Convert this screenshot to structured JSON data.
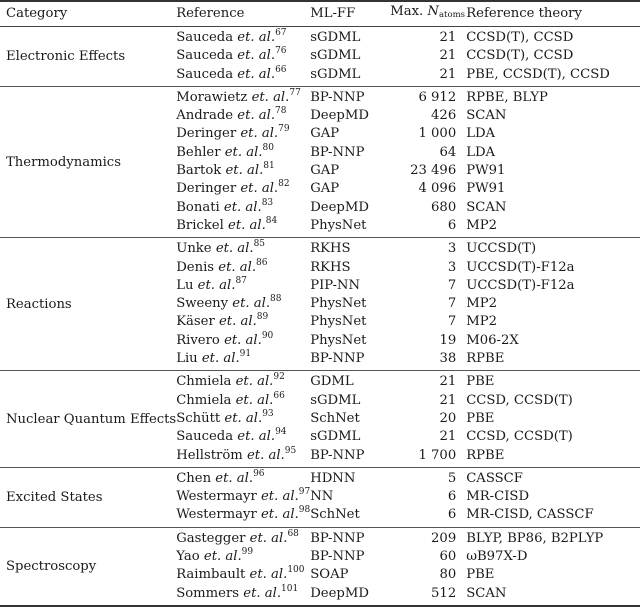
{
  "header": {
    "category": "Category",
    "reference": "Reference",
    "mlff": "ML-FF",
    "max_natoms_prefix": "Max.",
    "max_natoms_symbol": "N",
    "max_natoms_subscript": "atoms",
    "reference_theory": "Reference theory"
  },
  "etal": "et. al.",
  "groups": [
    {
      "category": "Electronic Effects",
      "rows": [
        {
          "author": "Sauceda",
          "ref": "67",
          "mlff": "sGDML",
          "natoms": "21",
          "theory": "CCSD(T), CCSD"
        },
        {
          "author": "Sauceda",
          "ref": "76",
          "mlff": "sGDML",
          "natoms": "21",
          "theory": "CCSD(T), CCSD"
        },
        {
          "author": "Sauceda",
          "ref": "66",
          "mlff": "sGDML",
          "natoms": "21",
          "theory": "PBE, CCSD(T), CCSD"
        }
      ]
    },
    {
      "category": "Thermodynamics",
      "rows": [
        {
          "author": "Morawietz",
          "ref": "77",
          "mlff": "BP-NNP",
          "natoms": "6 912",
          "theory": "RPBE, BLYP"
        },
        {
          "author": "Andrade",
          "ref": "78",
          "mlff": "DeepMD",
          "natoms": "426",
          "theory": "SCAN"
        },
        {
          "author": "Deringer",
          "ref": "79",
          "mlff": "GAP",
          "natoms": "1 000",
          "theory": "LDA"
        },
        {
          "author": "Behler",
          "ref": "80",
          "mlff": "BP-NNP",
          "natoms": "64",
          "theory": "LDA"
        },
        {
          "author": "Bartok",
          "ref": "81",
          "mlff": "GAP",
          "natoms": "23 496",
          "theory": "PW91"
        },
        {
          "author": "Deringer",
          "ref": "82",
          "mlff": "GAP",
          "natoms": "4 096",
          "theory": "PW91"
        },
        {
          "author": "Bonati",
          "ref": "83",
          "mlff": "DeepMD",
          "natoms": "680",
          "theory": "SCAN"
        },
        {
          "author": "Brickel",
          "ref": "84",
          "mlff": "PhysNet",
          "natoms": "6",
          "theory": "MP2"
        }
      ]
    },
    {
      "category": "Reactions",
      "rows": [
        {
          "author": "Unke",
          "ref": "85",
          "mlff": "RKHS",
          "natoms": "3",
          "theory": "UCCSD(T)"
        },
        {
          "author": "Denis",
          "ref": "86",
          "mlff": "RKHS",
          "natoms": "3",
          "theory": "UCCSD(T)-F12a"
        },
        {
          "author": "Lu",
          "ref": "87",
          "mlff": "PIP-NN",
          "natoms": "7",
          "theory": "UCCSD(T)-F12a"
        },
        {
          "author": "Sweeny",
          "ref": "88",
          "mlff": "PhysNet",
          "natoms": "7",
          "theory": "MP2"
        },
        {
          "author": "Käser",
          "ref": "89",
          "mlff": "PhysNet",
          "natoms": "7",
          "theory": "MP2"
        },
        {
          "author": "Rivero",
          "ref": "90",
          "mlff": "PhysNet",
          "natoms": "19",
          "theory": "M06-2X"
        },
        {
          "author": "Liu",
          "ref": "91",
          "mlff": "BP-NNP",
          "natoms": "38",
          "theory": "RPBE"
        }
      ]
    },
    {
      "category": "Nuclear Quantum Effects",
      "rows": [
        {
          "author": "Chmiela",
          "ref": "92",
          "mlff": "GDML",
          "natoms": "21",
          "theory": "PBE"
        },
        {
          "author": "Chmiela",
          "ref": "66",
          "mlff": "sGDML",
          "natoms": "21",
          "theory": "CCSD, CCSD(T)"
        },
        {
          "author": "Schütt",
          "ref": "93",
          "mlff": "SchNet",
          "natoms": "20",
          "theory": "PBE"
        },
        {
          "author": "Sauceda",
          "ref": "94",
          "mlff": "sGDML",
          "natoms": "21",
          "theory": "CCSD, CCSD(T)"
        },
        {
          "author": "Hellström",
          "ref": "95",
          "mlff": "BP-NNP",
          "natoms": "1 700",
          "theory": "RPBE"
        }
      ]
    },
    {
      "category": "Excited States",
      "rows": [
        {
          "author": "Chen",
          "ref": "96",
          "mlff": "HDNN",
          "natoms": "5",
          "theory": "CASSCF"
        },
        {
          "author": "Westermayr",
          "ref": "97",
          "mlff": "NN",
          "natoms": "6",
          "theory": "MR-CISD"
        },
        {
          "author": "Westermayr",
          "ref": "98",
          "mlff": "SchNet",
          "natoms": "6",
          "theory": "MR-CISD, CASSCF"
        }
      ]
    },
    {
      "category": "Spectroscopy",
      "rows": [
        {
          "author": "Gastegger",
          "ref": "68",
          "mlff": "BP-NNP",
          "natoms": "209",
          "theory": "BLYP, BP86, B2PLYP"
        },
        {
          "author": "Yao",
          "ref": "99",
          "mlff": "BP-NNP",
          "natoms": "60",
          "theory": "ωB97X-D"
        },
        {
          "author": "Raimbault",
          "ref": "100",
          "mlff": "SOAP",
          "natoms": "80",
          "theory": "PBE"
        },
        {
          "author": "Sommers",
          "ref": "101",
          "mlff": "DeepMD",
          "natoms": "512",
          "theory": "SCAN"
        }
      ]
    }
  ]
}
